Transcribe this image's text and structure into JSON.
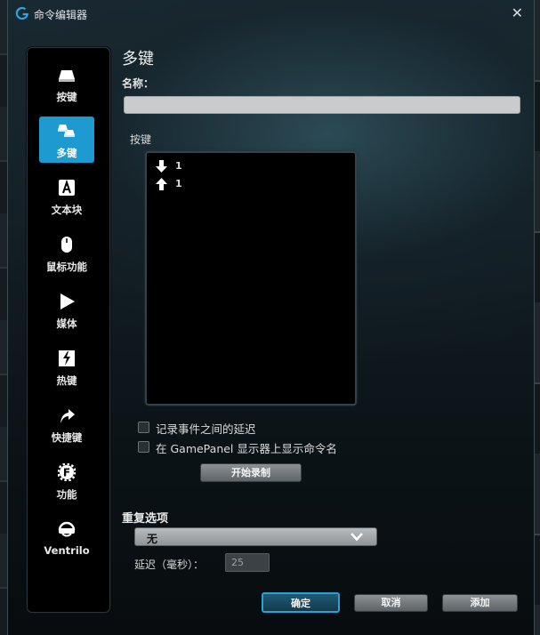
{
  "window": {
    "title": "命令编辑器"
  },
  "sidebar": {
    "items": [
      {
        "label": "按键",
        "icon": "keycap-icon"
      },
      {
        "label": "多键",
        "icon": "multikey-icon"
      },
      {
        "label": "文本块",
        "icon": "text-block-icon"
      },
      {
        "label": "鼠标功能",
        "icon": "mouse-icon"
      },
      {
        "label": "媒体",
        "icon": "play-icon"
      },
      {
        "label": "热键",
        "icon": "hotkey-icon"
      },
      {
        "label": "快捷键",
        "icon": "shortcut-arrow-icon"
      },
      {
        "label": "功能",
        "icon": "function-gear-icon"
      },
      {
        "label": "Ventrilo",
        "icon": "headset-icon"
      }
    ],
    "active_index": 1
  },
  "main": {
    "heading": "多键",
    "name_label": "名称：",
    "name_value": "",
    "keys_label": "按键",
    "keys": [
      {
        "direction": "down",
        "text": "1"
      },
      {
        "direction": "up",
        "text": "1"
      }
    ],
    "options": {
      "record_delay": "记录事件之间的延迟",
      "show_on_gamepanel": "在 GamePanel 显示器上显示命令名"
    },
    "record_button": "开始录制",
    "repeat_label": "重复选项",
    "repeat_value": "无",
    "delay_label": "延迟（毫秒）：",
    "delay_value": "25"
  },
  "footer": {
    "ok": "确定",
    "cancel": "取消",
    "add": "添加"
  },
  "colors": {
    "accent": "#1d9ad0",
    "panel": "#000000",
    "background": "#0b1317"
  }
}
